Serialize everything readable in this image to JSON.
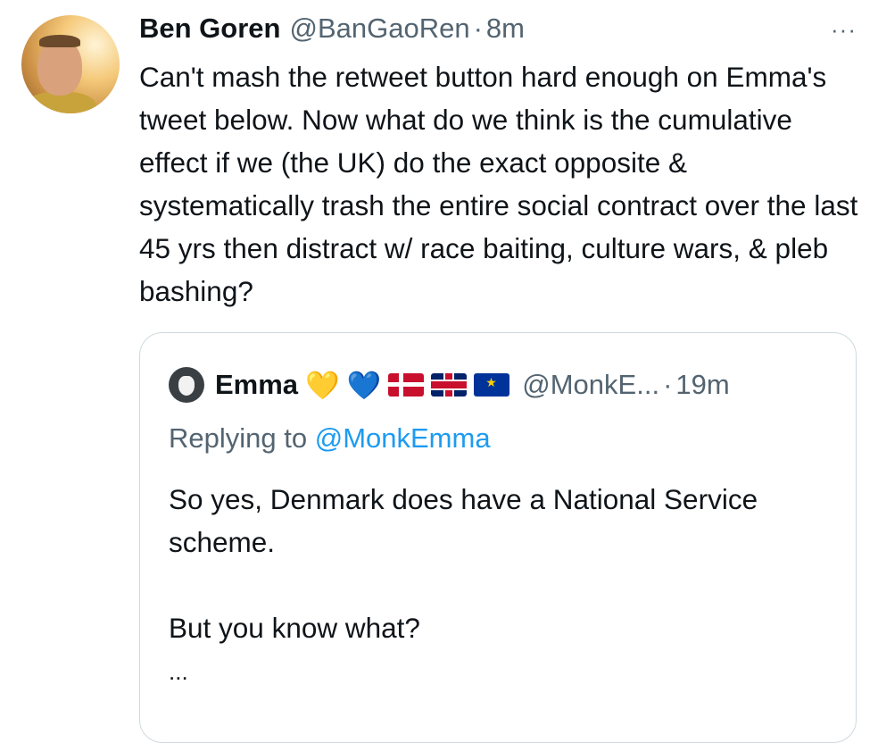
{
  "tweet": {
    "name": "Ben Goren",
    "handle": "@BanGaoRen",
    "separator": "·",
    "time": "8m",
    "more": "···",
    "text": "Can't mash the retweet button hard enough on Emma's tweet below. Now what do we think is the cumulative effect if we (the UK) do the exact opposite & systematically trash the entire social contract over the last 45 yrs then distract w/ race baiting, culture wars, & pleb bashing?"
  },
  "quote": {
    "name": "Emma",
    "emoji_yellow_heart": "💛",
    "emoji_blue_heart": "💙",
    "handle": "@MonkE...",
    "separator": "·",
    "time": "19m",
    "replying_prefix": "Replying to ",
    "replying_to": "@MonkEmma",
    "text": "So yes, Denmark does have a National Service scheme.\n\nBut you know what?",
    "ellipsis": "..."
  },
  "icons": [
    "avatar",
    "more-icon",
    "flag-denmark-icon",
    "flag-uk-icon",
    "flag-eu-icon"
  ]
}
